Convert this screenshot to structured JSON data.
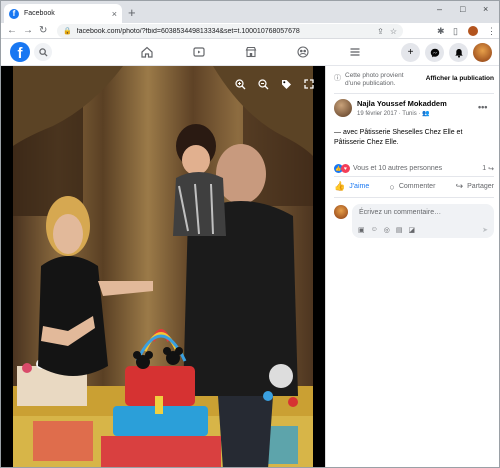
{
  "browser": {
    "tab_title": "Facebook",
    "tab_close": "×",
    "new_tab": "+",
    "url": "facebook.com/photo/?fbid=603853449813334&set=t.100010768057678",
    "window_controls": [
      "–",
      "□",
      "×"
    ],
    "nav_icons": [
      "back-icon",
      "forward-icon",
      "reload-icon"
    ]
  },
  "fb_nav": {
    "logo": "f",
    "center_icons": [
      "home-icon",
      "watch-icon",
      "marketplace-icon",
      "groups-icon",
      "menu-icon"
    ],
    "right_icons": [
      "create-icon",
      "messenger-icon",
      "notifications-icon",
      "account-avatar"
    ]
  },
  "viewer": {
    "close_icon": "×",
    "tools": [
      "zoom-in-icon",
      "zoom-out-icon",
      "tag-icon",
      "fullscreen-icon"
    ]
  },
  "post": {
    "notice_text": "Cette photo provient d'une publication.",
    "notice_link": "Afficher la publication",
    "author_name": "Najla Youssef Mokaddem",
    "meta": "19 février 2017 · Tunis · ",
    "caption": "— avec Pâtisserie Sheselles Chez Elle et Pâtisserie Chez Elle.",
    "reactions_text": "Vous et 10 autres personnes",
    "shares": "1",
    "actions": {
      "like": "J'aime",
      "comment": "Commenter",
      "share": "Partager"
    },
    "comment_placeholder": "Écrivez un commentaire…"
  },
  "colors": {
    "facebook_blue": "#1877f2",
    "like_reaction": "#1877f2",
    "love_reaction": "#f33e58"
  }
}
